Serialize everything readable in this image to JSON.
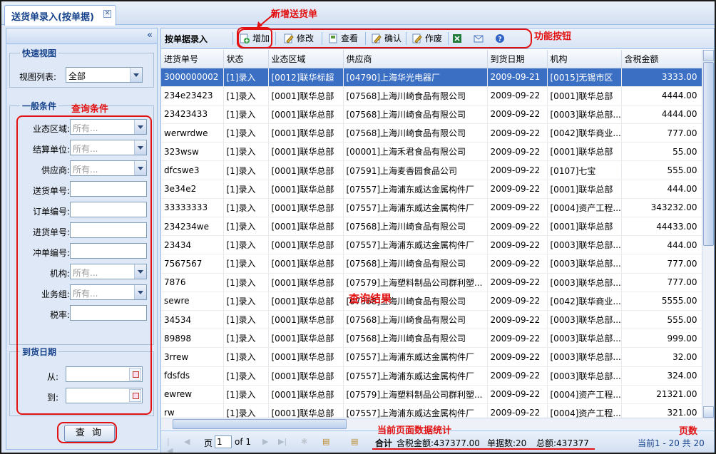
{
  "tab": {
    "title": "送货单录入(按单据)",
    "close": "✕"
  },
  "left": {
    "collapse": "«",
    "quick_view": {
      "legend": "快速视图",
      "view_label": "视图列表:",
      "view_value": "全部"
    },
    "general": {
      "legend": "一般条件",
      "fields": [
        {
          "label": "业态区域:",
          "type": "combo",
          "value": "所有..."
        },
        {
          "label": "结算单位:",
          "type": "combo",
          "value": "所有..."
        },
        {
          "label": "供应商:",
          "type": "combo",
          "value": "所有..."
        },
        {
          "label": "送货单号:",
          "type": "text",
          "value": ""
        },
        {
          "label": "订单编号:",
          "type": "text",
          "value": ""
        },
        {
          "label": "进货单号:",
          "type": "text",
          "value": ""
        },
        {
          "label": "冲单编号:",
          "type": "text",
          "value": ""
        },
        {
          "label": "机构:",
          "type": "combo",
          "value": "所有..."
        },
        {
          "label": "业务组:",
          "type": "combo",
          "value": "所有..."
        },
        {
          "label": "税率:",
          "type": "text",
          "value": ""
        }
      ]
    },
    "arrival": {
      "legend": "到货日期",
      "from_label": "从:",
      "to_label": "到:"
    },
    "query_button": "查 询"
  },
  "annotations": {
    "new_delivery": "新增送货单",
    "function_buttons": "功能按钮",
    "query_conditions": "查询条件",
    "query_results": "查询结果",
    "page_stats": "当前页面数据统计",
    "page_count": "页数"
  },
  "toolbar": {
    "title": "按单据录入",
    "buttons": [
      {
        "label": "增加",
        "icon": "add-icon"
      },
      {
        "label": "修改",
        "icon": "edit-icon"
      },
      {
        "label": "查看",
        "icon": "view-icon"
      },
      {
        "label": "确认",
        "icon": "confirm-icon"
      },
      {
        "label": "作废",
        "icon": "void-icon"
      },
      {
        "label": "",
        "icon": "excel-icon"
      },
      {
        "label": "",
        "icon": "mail-icon"
      },
      {
        "label": "",
        "icon": "help-icon"
      }
    ]
  },
  "grid": {
    "columns": [
      "进货单号",
      "状态",
      "业态区域",
      "供应商",
      "到货日期",
      "机构",
      "含税金额"
    ],
    "rows": [
      [
        "3000000002",
        "[1]录入",
        "[0012]联华标超",
        "[04790]上海华光电器厂",
        "2009-09-21",
        "[0015]无锡市区",
        "3333.00"
      ],
      [
        "234e23423",
        "[1]录入",
        "[0001]联华总部",
        "[07568]上海川崎食品有限公司",
        "2009-09-22",
        "[0001]联华总部",
        "4444.00"
      ],
      [
        "23423433",
        "[1]录入",
        "[0001]联华总部",
        "[07568]上海川崎食品有限公司",
        "2009-09-22",
        "[0003]联华总部...",
        "4444.00"
      ],
      [
        "werwrdwe",
        "[1]录入",
        "[0001]联华总部",
        "[07568]上海川崎食品有限公司",
        "2009-09-22",
        "[0042]联华商业...",
        "777.00"
      ],
      [
        "323wsw",
        "[1]录入",
        "[0001]联华总部",
        "[00001]上海禾君食品有限公司",
        "2009-09-22",
        "[0001]联华总部",
        "55.00"
      ],
      [
        "dfcswe3",
        "[1]录入",
        "[0001]联华总部",
        "[07591]上海麦香园食品公司",
        "2009-09-22",
        "[0107]七宝",
        "555.00"
      ],
      [
        "3e34e2",
        "[1]录入",
        "[0001]联华总部",
        "[07557]上海浦东威达金属构件厂",
        "2009-09-22",
        "[0001]联华总部",
        "444.00"
      ],
      [
        "33333333",
        "[1]录入",
        "[0001]联华总部",
        "[07557]上海浦东威达金属构件厂",
        "2009-09-22",
        "[0004]资产工程...",
        "343232.00"
      ],
      [
        "234234we",
        "[1]录入",
        "[0001]联华总部",
        "[07568]上海川崎食品有限公司",
        "2009-09-22",
        "[0001]联华总部",
        "44433.00"
      ],
      [
        "23434",
        "[1]录入",
        "[0001]联华总部",
        "[07557]上海浦东威达金属构件厂",
        "2009-09-22",
        "[0003]联华总部...",
        "444.00"
      ],
      [
        "7567567",
        "[1]录入",
        "[0001]联华总部",
        "[07568]上海川崎食品有限公司",
        "2009-09-22",
        "[0003]联华总部...",
        "777.00"
      ],
      [
        "7876",
        "[1]录入",
        "[0001]联华总部",
        "[07579]上海塑料制品公司群利塑...",
        "2009-09-22",
        "[0003]联华总部...",
        "777.00"
      ],
      [
        "sewre",
        "[1]录入",
        "[0001]联华总部",
        "[07568]上海川崎食品有限公司",
        "2009-09-22",
        "[0042]联华商业...",
        "5555.00"
      ],
      [
        "34534",
        "[1]录入",
        "[0001]联华总部",
        "[07568]上海川崎食品有限公司",
        "2009-09-22",
        "[0003]联华总部...",
        "555.00"
      ],
      [
        "89898",
        "[1]录入",
        "[0001]联华总部",
        "[07568]上海川崎食品有限公司",
        "2009-09-22",
        "[0003]联华总部...",
        "999.00"
      ],
      [
        "3rrew",
        "[1]录入",
        "[0001]联华总部",
        "[07557]上海浦东威达金属构件厂",
        "2009-09-22",
        "[0003]联华总部...",
        "32.00"
      ],
      [
        "fdsfds",
        "[1]录入",
        "[0001]联华总部",
        "[07557]上海浦东威达金属构件厂",
        "2009-09-22",
        "[0003]联华总部...",
        "324.00"
      ],
      [
        "ewrew",
        "[1]录入",
        "[0001]联华总部",
        "[07579]上海塑料制品公司群利塑...",
        "2009-09-22",
        "[0004]资产工程...",
        "21321.00"
      ],
      [
        "rw",
        "[1]录入",
        "[0001]联华总部",
        "[07557]上海浦东威达金属构件厂",
        "2009-09-22",
        "[0004]资产工程...",
        "321.00"
      ]
    ],
    "selected_row": 0
  },
  "pager": {
    "page_label": "页",
    "page_value": "1",
    "of_label": "of 1",
    "sum_label": "合计",
    "tax_amount": "含税金额:437377.00",
    "doc_count": "单据数:20",
    "total": "总额:437377",
    "range": "当前1 - 20 共 20"
  },
  "colors": {
    "accent": "#15428b",
    "selection": "#3a6fc4",
    "annotation": "#e21212"
  }
}
